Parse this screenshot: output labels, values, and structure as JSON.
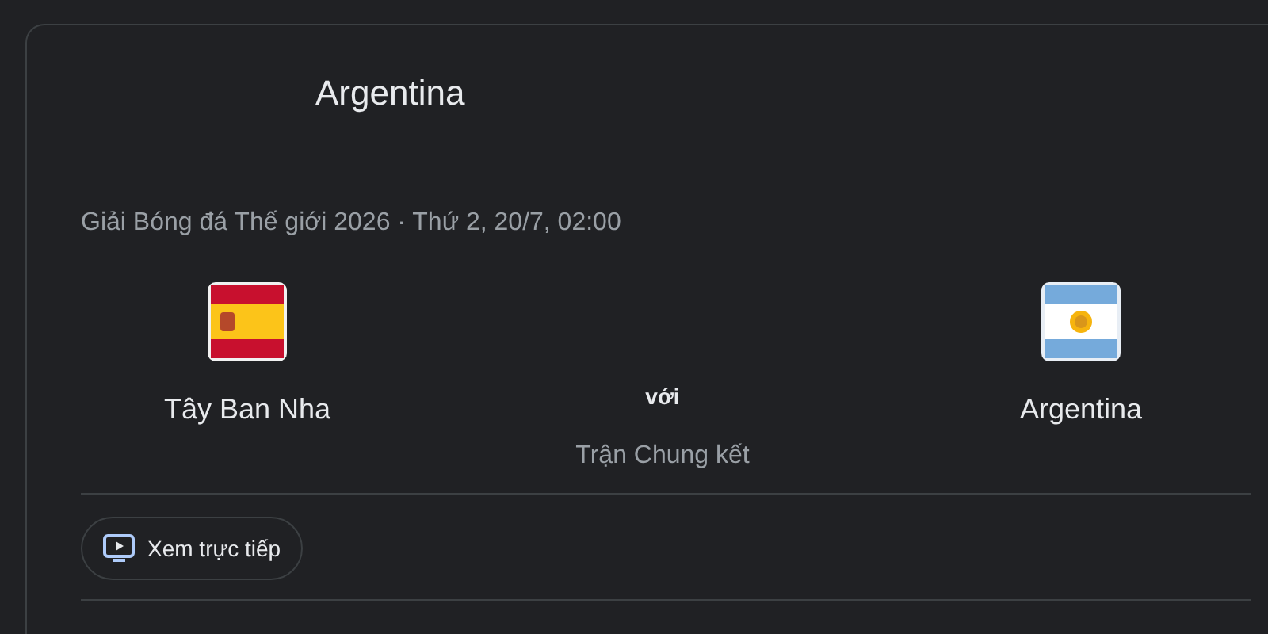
{
  "header": {
    "title": "Argentina"
  },
  "match": {
    "info": "Giải Bóng đá Thế giới 2026 · Thứ 2, 20/7, 02:00",
    "teams": [
      {
        "name": "Tây Ban Nha",
        "kind": "spain"
      },
      {
        "name": "Argentina",
        "kind": "argentina"
      }
    ],
    "versus": "với",
    "stage": "Trận Chung kết"
  },
  "actions": [
    {
      "label": "Xem trực tiếp"
    }
  ]
}
